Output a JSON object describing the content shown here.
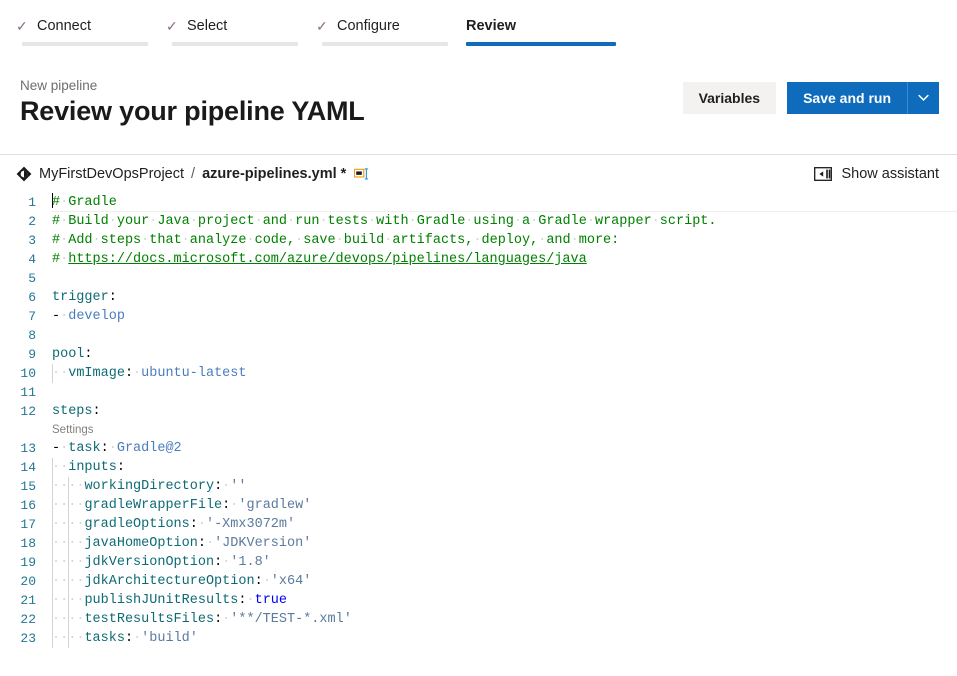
{
  "wizard": {
    "steps": [
      {
        "label": "Connect",
        "check": "✓",
        "completed": true,
        "active": false
      },
      {
        "label": "Select",
        "check": "✓",
        "completed": true,
        "active": false
      },
      {
        "label": "Configure",
        "check": "✓",
        "completed": true,
        "active": false
      },
      {
        "label": "Review",
        "check": "",
        "completed": false,
        "active": true
      }
    ],
    "active_color": "#0f6cbd",
    "completed_bar_color": "#e6e6e6"
  },
  "header": {
    "eyebrow": "New pipeline",
    "title": "Review your pipeline YAML",
    "variables_label": "Variables",
    "save_and_run_label": "Save and run",
    "split_arrow_glyph": "⌄",
    "primary_color": "#0f6cbd",
    "secondary_color": "#f3f2f1"
  },
  "file_bar": {
    "repo_name": "MyFirstDevOpsProject",
    "separator": "/",
    "file_name": "azure-pipelines.yml",
    "dirty_marker": "*",
    "rename_icon": "rename-icon",
    "assistant_label": "Show assistant",
    "assistant_icon": "panel-right-icon"
  },
  "editor": {
    "codelens_label": "Settings",
    "codelens_after_line": 12,
    "comment_color": "#008000",
    "key_color": "#0e6b75",
    "string_color": "#5a7a9e",
    "keyword_color": "#0000ff",
    "line_number_color": "#237893",
    "lines": [
      {
        "n": 1,
        "text": "# Gradle"
      },
      {
        "n": 2,
        "text": "# Build your Java project and run tests with Gradle using a Gradle wrapper script."
      },
      {
        "n": 3,
        "text": "# Add steps that analyze code, save build artifacts, deploy, and more:"
      },
      {
        "n": 4,
        "text": "# https://docs.microsoft.com/azure/devops/pipelines/languages/java"
      },
      {
        "n": 5,
        "text": ""
      },
      {
        "n": 6,
        "text": "trigger:"
      },
      {
        "n": 7,
        "text": "- develop"
      },
      {
        "n": 8,
        "text": ""
      },
      {
        "n": 9,
        "text": "pool:"
      },
      {
        "n": 10,
        "text": "  vmImage: ubuntu-latest"
      },
      {
        "n": 11,
        "text": ""
      },
      {
        "n": 12,
        "text": "steps:"
      },
      {
        "n": 13,
        "text": "- task: Gradle@2"
      },
      {
        "n": 14,
        "text": "  inputs:"
      },
      {
        "n": 15,
        "text": "    workingDirectory: ''"
      },
      {
        "n": 16,
        "text": "    gradleWrapperFile: 'gradlew'"
      },
      {
        "n": 17,
        "text": "    gradleOptions: '-Xmx3072m'"
      },
      {
        "n": 18,
        "text": "    javaHomeOption: 'JDKVersion'"
      },
      {
        "n": 19,
        "text": "    jdkVersionOption: '1.8'"
      },
      {
        "n": 20,
        "text": "    jdkArchitectureOption: 'x64'"
      },
      {
        "n": 21,
        "text": "    publishJUnitResults: true"
      },
      {
        "n": 22,
        "text": "    testResultsFiles: '**/TEST-*.xml'"
      },
      {
        "n": 23,
        "text": "    tasks: 'build'"
      }
    ]
  }
}
